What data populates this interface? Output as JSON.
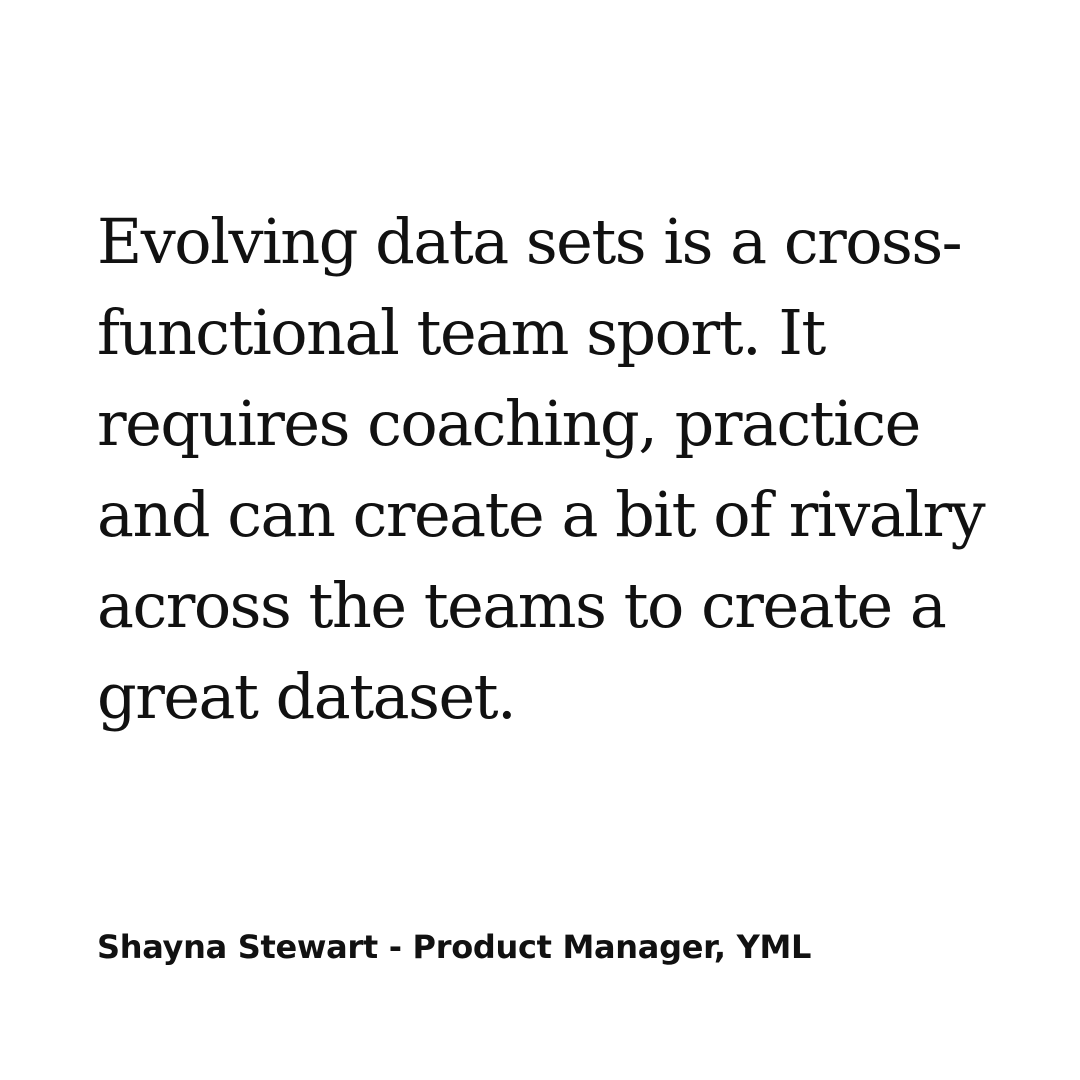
{
  "quote": {
    "lines": [
      "Evolving data sets is a cross-",
      "functional team sport. It",
      "requires coaching, practice",
      "and can create a bit of rivalry",
      "across the teams to create a",
      "great dataset."
    ]
  },
  "attribution": {
    "text": "Shayna Stewart - Product Manager, YML"
  },
  "colors": {
    "background": "#ffffff",
    "text": "#111111"
  }
}
